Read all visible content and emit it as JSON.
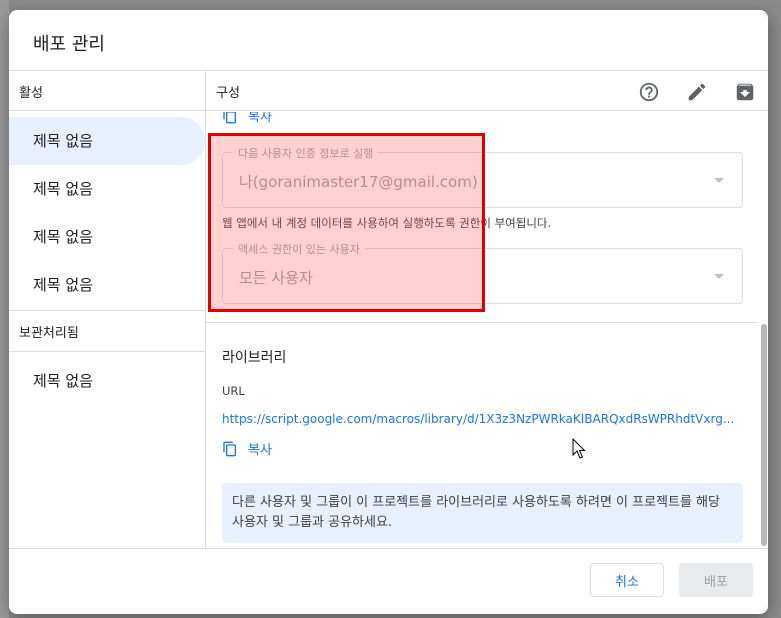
{
  "dialog": {
    "title": "배포 관리"
  },
  "left_panel": {
    "active_header": "활성",
    "active_items": [
      {
        "label": "제목 없음"
      },
      {
        "label": "제목 없음"
      },
      {
        "label": "제목 없음"
      },
      {
        "label": "제목 없음"
      }
    ],
    "archived_header": "보관처리됨",
    "archived_items": [
      {
        "label": "제목 없음"
      }
    ]
  },
  "right_panel": {
    "header": "구성",
    "toolbar": {
      "help_icon": "help-circle-icon",
      "edit_icon": "pencil-icon",
      "archive_icon": "archive-icon"
    },
    "copy_label_top": "복사",
    "execute_as": {
      "label": "다음 사용자 인증 정보로 실행",
      "value": "나(goranimaster17@gmail.com)"
    },
    "helper_text": "웹 앱에서 내 계정 데이터를 사용하여 실행하도록 권한이 부여됩니다.",
    "access": {
      "label": "액세스 권한이 있는 사용자",
      "value": "모든 사용자"
    },
    "library_title": "라이브러리",
    "url_label": "URL",
    "url_value": "https://script.google.com/macros/library/d/1X3z3NzPWRkaKIBARQxdRsWPRhdtVxrg...",
    "copy_label_bottom": "복사",
    "info_text": "다른 사용자 및 그룹이 이 프로젝트를 라이브러리로 사용하도록 하려면 이 프로젝트를 해당 사용자 및 그룹과 공유하세요."
  },
  "footer": {
    "cancel_label": "취소",
    "deploy_label": "배포"
  },
  "colors": {
    "accent": "#1a73e8",
    "active_item_bg": "#e8f0fe",
    "highlight_border": "#e00000"
  }
}
